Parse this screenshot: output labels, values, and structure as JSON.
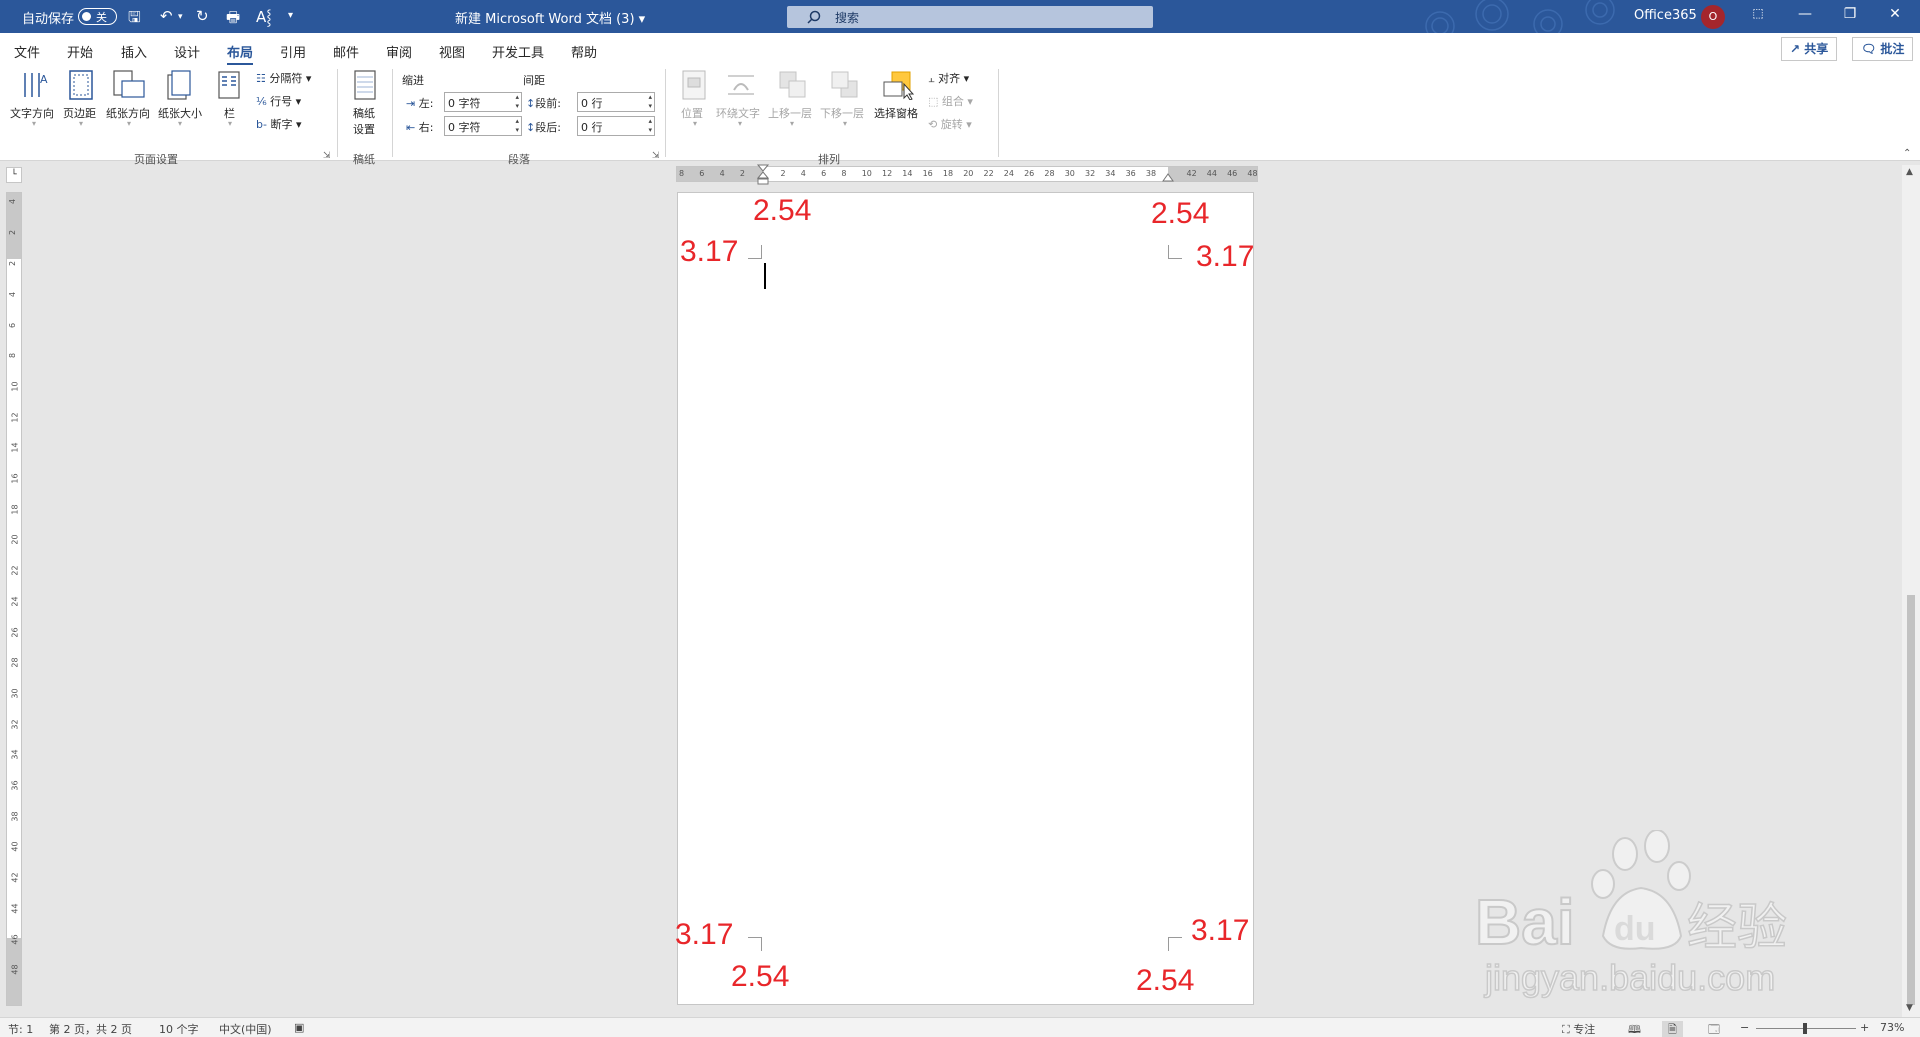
{
  "titlebar": {
    "autosave_label": "自动保存",
    "autosave_state": "关",
    "doc_title": "新建 Microsoft Word 文档 (3)",
    "title_caret": "▾",
    "search_placeholder": "搜索",
    "account_name": "Office365",
    "avatar_initial": "O",
    "quick_access": [
      "save-icon",
      "undo-icon",
      "redo-icon",
      "print-preview-icon",
      "read-aloud-icon",
      "customize-icon"
    ]
  },
  "tabs": [
    "文件",
    "开始",
    "插入",
    "设计",
    "布局",
    "引用",
    "邮件",
    "审阅",
    "视图",
    "开发工具",
    "帮助"
  ],
  "active_tab": "布局",
  "share_label": "共享",
  "comments_label": "批注",
  "ribbon": {
    "page_setup": {
      "text_direction": "文字方向",
      "margins": "页边距",
      "orientation": "纸张方向",
      "size": "纸张大小",
      "columns": "栏",
      "breaks": "分隔符",
      "line_numbers": "行号",
      "hyphenation": "断字",
      "group_label": "页面设置"
    },
    "manuscript": {
      "settings": "稿纸\n设置",
      "settings_l1": "稿纸",
      "settings_l2": "设置",
      "group_label": "稿纸"
    },
    "paragraph": {
      "indent_header": "缩进",
      "spacing_header": "间距",
      "left_label": "左:",
      "left_value": "0 字符",
      "right_label": "右:",
      "right_value": "0 字符",
      "before_label": "段前:",
      "before_value": "0 行",
      "after_label": "段后:",
      "after_value": "0 行",
      "group_label": "段落"
    },
    "arrange": {
      "position": "位置",
      "wrap_text": "环绕文字",
      "bring_forward": "上移一层",
      "send_backward": "下移一层",
      "selection_pane": "选择窗格",
      "align": "对齐",
      "group": "组合",
      "rotate": "旋转",
      "group_label": "排列"
    }
  },
  "ruler": {
    "h_ticks": [
      "8",
      "6",
      "4",
      "2",
      "2",
      "4",
      "6",
      "8",
      "10",
      "12",
      "14",
      "16",
      "18",
      "20",
      "22",
      "24",
      "26",
      "28",
      "30",
      "32",
      "34",
      "36",
      "38",
      "42",
      "44",
      "46",
      "48"
    ],
    "v_ticks": [
      "4",
      "2",
      "2",
      "4",
      "6",
      "8",
      "10",
      "12",
      "14",
      "16",
      "18",
      "20",
      "22",
      "24",
      "26",
      "28",
      "30",
      "32",
      "34",
      "36",
      "38",
      "40",
      "42",
      "44",
      "46",
      "48"
    ]
  },
  "annotations": {
    "top_left_top": "2.54",
    "top_left_side": "3.17",
    "top_right_top": "2.54",
    "top_right_side": "3.17",
    "bottom_left_side": "3.17",
    "bottom_left_bottom": "2.54",
    "bottom_right_side": "3.17",
    "bottom_right_bottom": "2.54"
  },
  "status": {
    "section": "节: 1",
    "page": "第 2 页，共 2 页",
    "words": "10 个字",
    "language": "中文(中国)",
    "focus": "专注",
    "zoom": "73%",
    "zoom_fraction": 0.73
  },
  "watermark": {
    "brand": "Bai",
    "brand_suffix": "du",
    "brand_cn": "经验",
    "url": "jingyan.baidu.com"
  },
  "colors": {
    "titlebar": "#2b579a",
    "annotation": "#e8262a",
    "avatar": "#a4262c"
  }
}
